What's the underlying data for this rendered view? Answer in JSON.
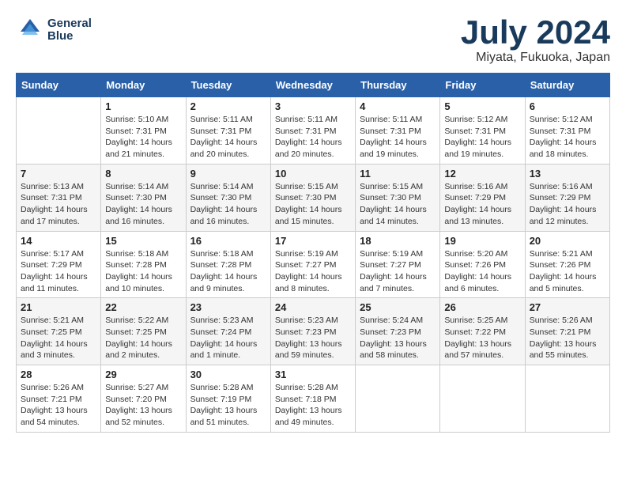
{
  "header": {
    "logo_line1": "General",
    "logo_line2": "Blue",
    "title": "July 2024",
    "subtitle": "Miyata, Fukuoka, Japan"
  },
  "columns": [
    "Sunday",
    "Monday",
    "Tuesday",
    "Wednesday",
    "Thursday",
    "Friday",
    "Saturday"
  ],
  "weeks": [
    [
      {
        "day": "",
        "info": ""
      },
      {
        "day": "1",
        "info": "Sunrise: 5:10 AM\nSunset: 7:31 PM\nDaylight: 14 hours\nand 21 minutes."
      },
      {
        "day": "2",
        "info": "Sunrise: 5:11 AM\nSunset: 7:31 PM\nDaylight: 14 hours\nand 20 minutes."
      },
      {
        "day": "3",
        "info": "Sunrise: 5:11 AM\nSunset: 7:31 PM\nDaylight: 14 hours\nand 20 minutes."
      },
      {
        "day": "4",
        "info": "Sunrise: 5:11 AM\nSunset: 7:31 PM\nDaylight: 14 hours\nand 19 minutes."
      },
      {
        "day": "5",
        "info": "Sunrise: 5:12 AM\nSunset: 7:31 PM\nDaylight: 14 hours\nand 19 minutes."
      },
      {
        "day": "6",
        "info": "Sunrise: 5:12 AM\nSunset: 7:31 PM\nDaylight: 14 hours\nand 18 minutes."
      }
    ],
    [
      {
        "day": "7",
        "info": "Sunrise: 5:13 AM\nSunset: 7:31 PM\nDaylight: 14 hours\nand 17 minutes."
      },
      {
        "day": "8",
        "info": "Sunrise: 5:14 AM\nSunset: 7:30 PM\nDaylight: 14 hours\nand 16 minutes."
      },
      {
        "day": "9",
        "info": "Sunrise: 5:14 AM\nSunset: 7:30 PM\nDaylight: 14 hours\nand 16 minutes."
      },
      {
        "day": "10",
        "info": "Sunrise: 5:15 AM\nSunset: 7:30 PM\nDaylight: 14 hours\nand 15 minutes."
      },
      {
        "day": "11",
        "info": "Sunrise: 5:15 AM\nSunset: 7:30 PM\nDaylight: 14 hours\nand 14 minutes."
      },
      {
        "day": "12",
        "info": "Sunrise: 5:16 AM\nSunset: 7:29 PM\nDaylight: 14 hours\nand 13 minutes."
      },
      {
        "day": "13",
        "info": "Sunrise: 5:16 AM\nSunset: 7:29 PM\nDaylight: 14 hours\nand 12 minutes."
      }
    ],
    [
      {
        "day": "14",
        "info": "Sunrise: 5:17 AM\nSunset: 7:29 PM\nDaylight: 14 hours\nand 11 minutes."
      },
      {
        "day": "15",
        "info": "Sunrise: 5:18 AM\nSunset: 7:28 PM\nDaylight: 14 hours\nand 10 minutes."
      },
      {
        "day": "16",
        "info": "Sunrise: 5:18 AM\nSunset: 7:28 PM\nDaylight: 14 hours\nand 9 minutes."
      },
      {
        "day": "17",
        "info": "Sunrise: 5:19 AM\nSunset: 7:27 PM\nDaylight: 14 hours\nand 8 minutes."
      },
      {
        "day": "18",
        "info": "Sunrise: 5:19 AM\nSunset: 7:27 PM\nDaylight: 14 hours\nand 7 minutes."
      },
      {
        "day": "19",
        "info": "Sunrise: 5:20 AM\nSunset: 7:26 PM\nDaylight: 14 hours\nand 6 minutes."
      },
      {
        "day": "20",
        "info": "Sunrise: 5:21 AM\nSunset: 7:26 PM\nDaylight: 14 hours\nand 5 minutes."
      }
    ],
    [
      {
        "day": "21",
        "info": "Sunrise: 5:21 AM\nSunset: 7:25 PM\nDaylight: 14 hours\nand 3 minutes."
      },
      {
        "day": "22",
        "info": "Sunrise: 5:22 AM\nSunset: 7:25 PM\nDaylight: 14 hours\nand 2 minutes."
      },
      {
        "day": "23",
        "info": "Sunrise: 5:23 AM\nSunset: 7:24 PM\nDaylight: 14 hours\nand 1 minute."
      },
      {
        "day": "24",
        "info": "Sunrise: 5:23 AM\nSunset: 7:23 PM\nDaylight: 13 hours\nand 59 minutes."
      },
      {
        "day": "25",
        "info": "Sunrise: 5:24 AM\nSunset: 7:23 PM\nDaylight: 13 hours\nand 58 minutes."
      },
      {
        "day": "26",
        "info": "Sunrise: 5:25 AM\nSunset: 7:22 PM\nDaylight: 13 hours\nand 57 minutes."
      },
      {
        "day": "27",
        "info": "Sunrise: 5:26 AM\nSunset: 7:21 PM\nDaylight: 13 hours\nand 55 minutes."
      }
    ],
    [
      {
        "day": "28",
        "info": "Sunrise: 5:26 AM\nSunset: 7:21 PM\nDaylight: 13 hours\nand 54 minutes."
      },
      {
        "day": "29",
        "info": "Sunrise: 5:27 AM\nSunset: 7:20 PM\nDaylight: 13 hours\nand 52 minutes."
      },
      {
        "day": "30",
        "info": "Sunrise: 5:28 AM\nSunset: 7:19 PM\nDaylight: 13 hours\nand 51 minutes."
      },
      {
        "day": "31",
        "info": "Sunrise: 5:28 AM\nSunset: 7:18 PM\nDaylight: 13 hours\nand 49 minutes."
      },
      {
        "day": "",
        "info": ""
      },
      {
        "day": "",
        "info": ""
      },
      {
        "day": "",
        "info": ""
      }
    ]
  ]
}
